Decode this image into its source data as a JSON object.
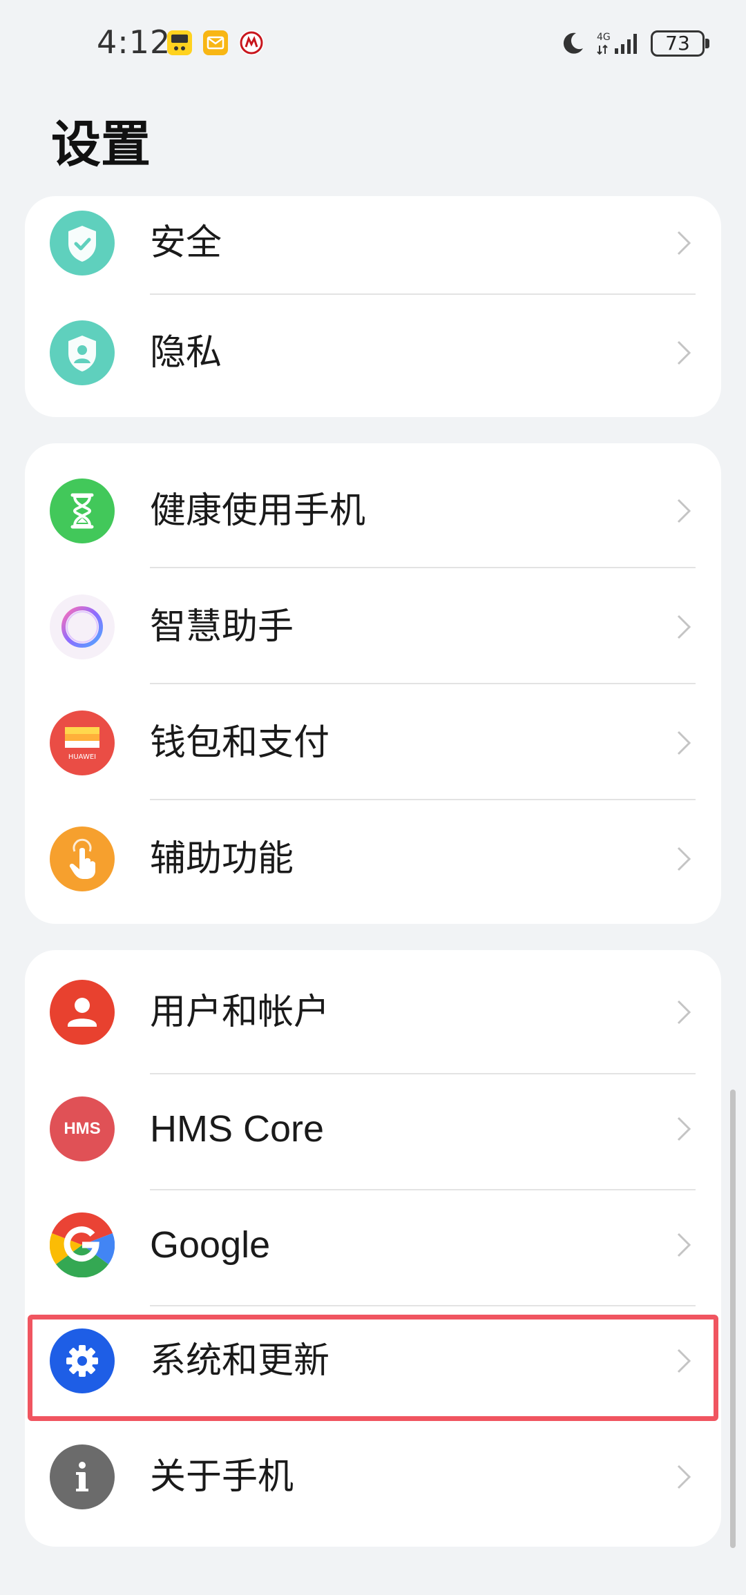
{
  "status_bar": {
    "time": "4:12",
    "network_text": "4G",
    "battery": "73"
  },
  "page": {
    "title": "设置"
  },
  "groups": [
    {
      "items": [
        {
          "label": "安全",
          "icon": "shield-check-icon",
          "color": "#5fd0bd"
        },
        {
          "label": "隐私",
          "icon": "privacy-shield-icon",
          "color": "#5fd0bd"
        }
      ]
    },
    {
      "items": [
        {
          "label": "健康使用手机",
          "icon": "hourglass-icon",
          "color": "#42c85a"
        },
        {
          "label": "智慧助手",
          "icon": "celia-ring-icon",
          "color": "#f4eff8"
        },
        {
          "label": "钱包和支付",
          "icon": "huawei-wallet-icon",
          "color": "#ea4d45"
        },
        {
          "label": "辅助功能",
          "icon": "hand-touch-icon",
          "color": "#f6a02e"
        }
      ]
    },
    {
      "items": [
        {
          "label": "用户和帐户",
          "icon": "user-icon",
          "color": "#e8412f"
        },
        {
          "label": "HMS Core",
          "icon": "hms-icon",
          "color": "#e05156"
        },
        {
          "label": "Google",
          "icon": "google-icon",
          "color": "#ffffff"
        },
        {
          "label": "系统和更新",
          "icon": "gear-icon",
          "color": "#1e5ee6"
        },
        {
          "label": "关于手机",
          "icon": "info-icon",
          "color": "#6b6b6b"
        }
      ]
    }
  ],
  "icon_text": {
    "wallet_brand": "HUAWEI",
    "hms": "HMS"
  },
  "highlight_color": "#f05560"
}
